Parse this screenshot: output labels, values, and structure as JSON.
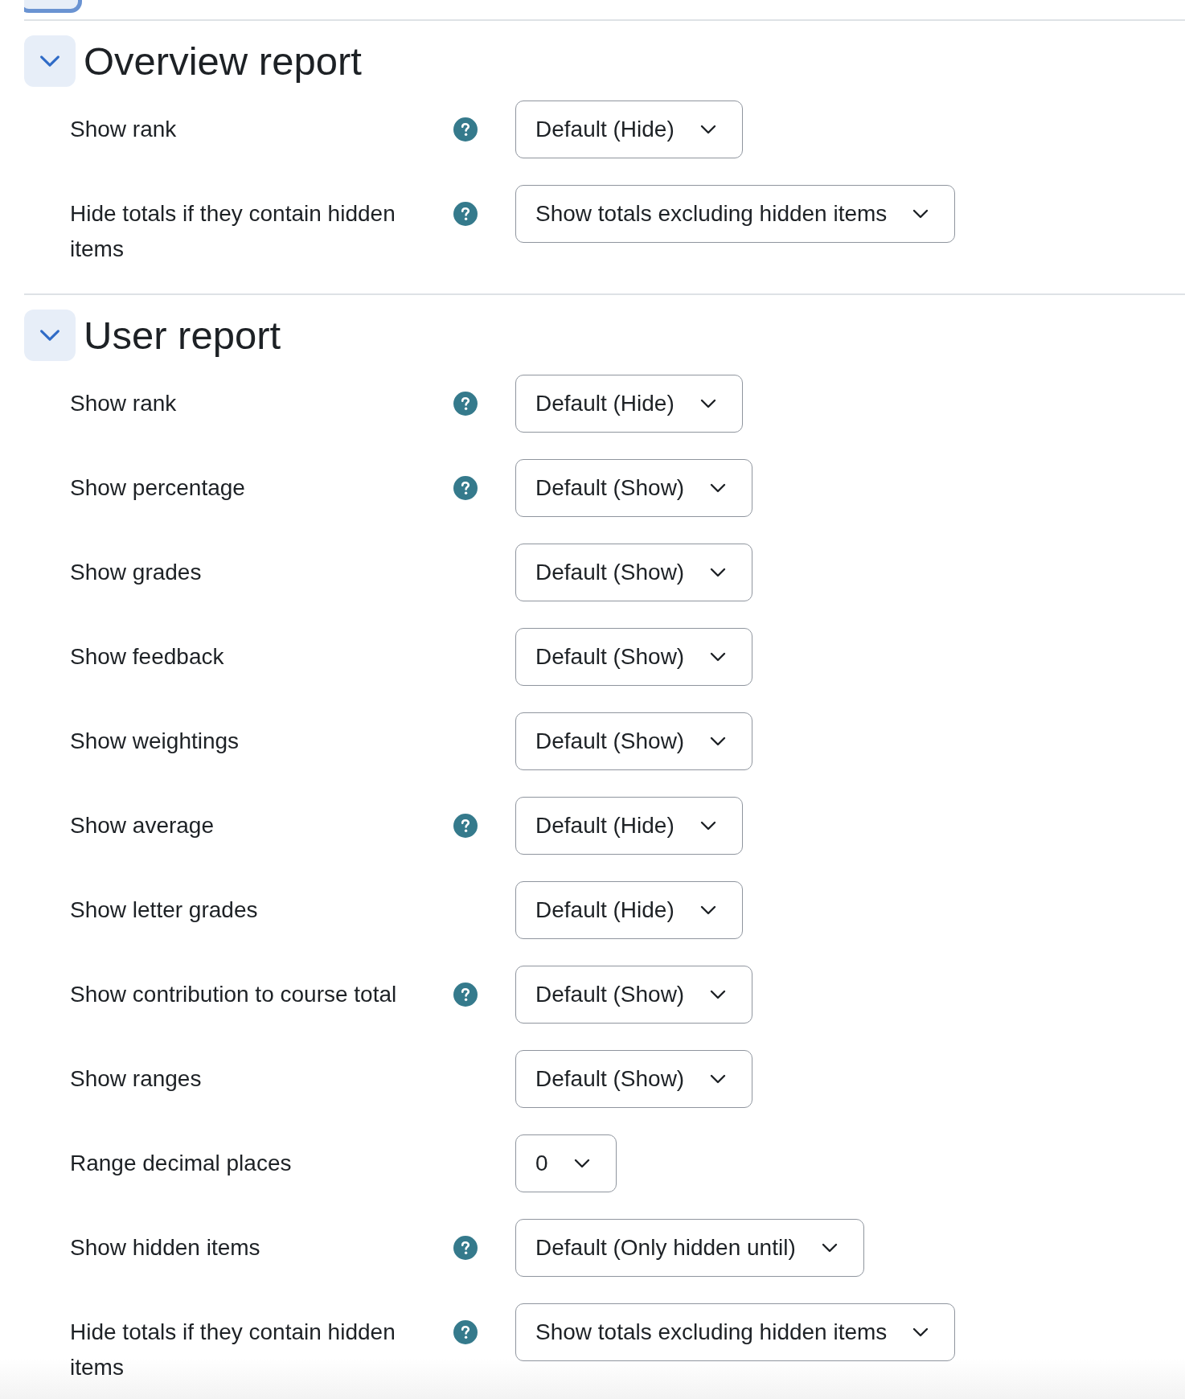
{
  "sections": [
    {
      "title": "Overview report",
      "expanded": true,
      "settings": [
        {
          "label": "Show rank",
          "help": true,
          "value": "Default (Hide)"
        },
        {
          "label": "Hide totals if they contain hidden items",
          "help": true,
          "value": "Show totals excluding hidden items"
        }
      ]
    },
    {
      "title": "User report",
      "expanded": true,
      "settings": [
        {
          "label": "Show rank",
          "help": true,
          "value": "Default (Hide)"
        },
        {
          "label": "Show percentage",
          "help": true,
          "value": "Default (Show)"
        },
        {
          "label": "Show grades",
          "help": false,
          "value": "Default (Show)"
        },
        {
          "label": "Show feedback",
          "help": false,
          "value": "Default (Show)"
        },
        {
          "label": "Show weightings",
          "help": false,
          "value": "Default (Show)"
        },
        {
          "label": "Show average",
          "help": true,
          "value": "Default (Hide)"
        },
        {
          "label": "Show letter grades",
          "help": false,
          "value": "Default (Hide)"
        },
        {
          "label": "Show contribution to course total",
          "help": true,
          "value": "Default (Show)"
        },
        {
          "label": "Show ranges",
          "help": false,
          "value": "Default (Show)"
        },
        {
          "label": "Range decimal places",
          "help": false,
          "value": "0"
        },
        {
          "label": "Show hidden items",
          "help": true,
          "value": "Default (Only hidden until)"
        },
        {
          "label": "Hide totals if they contain hidden items",
          "help": true,
          "value": "Show totals excluding hidden items"
        }
      ]
    }
  ]
}
